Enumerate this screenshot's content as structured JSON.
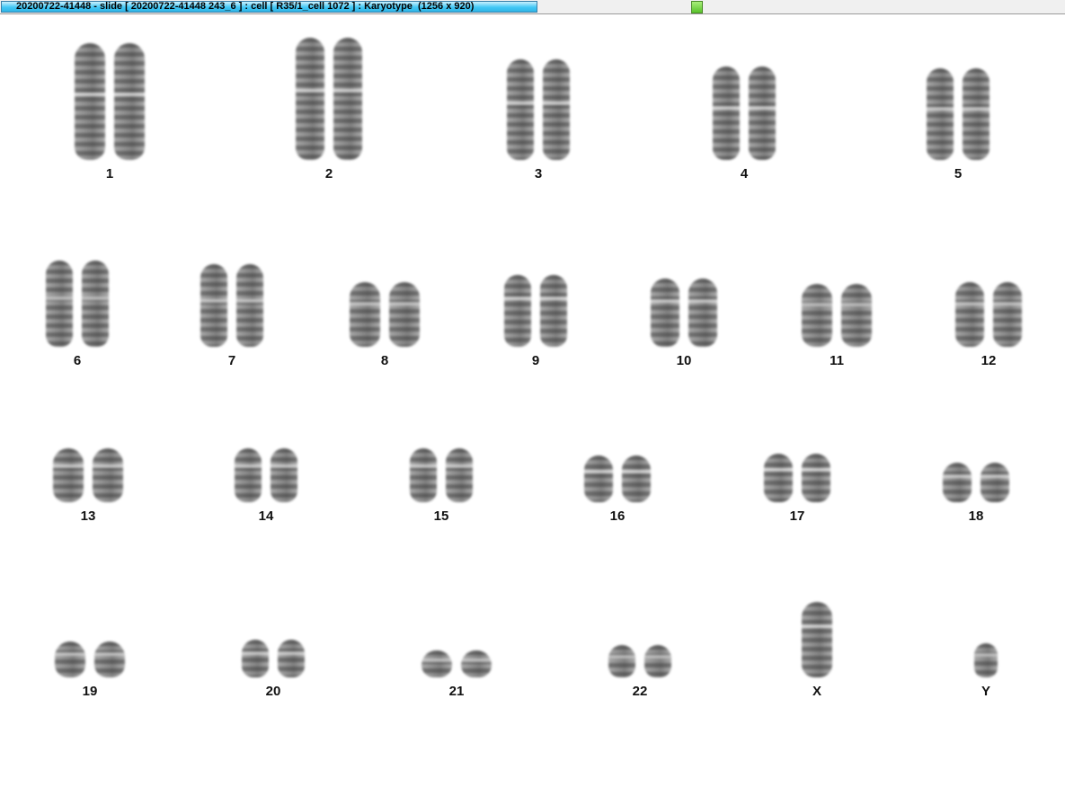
{
  "window": {
    "title": "20200722-41448 - slide [ 20200722-41448 243_6 ] : cell [ R35/1_cell 1072 ] : Karyotype  (1256 x 920)"
  },
  "karyotype": {
    "chromosomes": [
      {
        "label": "1",
        "count": 2
      },
      {
        "label": "2",
        "count": 2
      },
      {
        "label": "3",
        "count": 2
      },
      {
        "label": "4",
        "count": 2
      },
      {
        "label": "5",
        "count": 2
      },
      {
        "label": "6",
        "count": 2
      },
      {
        "label": "7",
        "count": 2
      },
      {
        "label": "8",
        "count": 2
      },
      {
        "label": "9",
        "count": 2
      },
      {
        "label": "10",
        "count": 2
      },
      {
        "label": "11",
        "count": 2
      },
      {
        "label": "12",
        "count": 2
      },
      {
        "label": "13",
        "count": 2
      },
      {
        "label": "14",
        "count": 2
      },
      {
        "label": "15",
        "count": 2
      },
      {
        "label": "16",
        "count": 2
      },
      {
        "label": "17",
        "count": 2
      },
      {
        "label": "18",
        "count": 2
      },
      {
        "label": "19",
        "count": 2
      },
      {
        "label": "20",
        "count": 2
      },
      {
        "label": "21",
        "count": 2
      },
      {
        "label": "22",
        "count": 2
      },
      {
        "label": "X",
        "count": 1
      },
      {
        "label": "Y",
        "count": 1
      }
    ]
  },
  "colors": {
    "titlebar_accent": "#43c8f5",
    "status_indicator": "#58c22a",
    "chromosome_stain": "#6f6f6f"
  }
}
